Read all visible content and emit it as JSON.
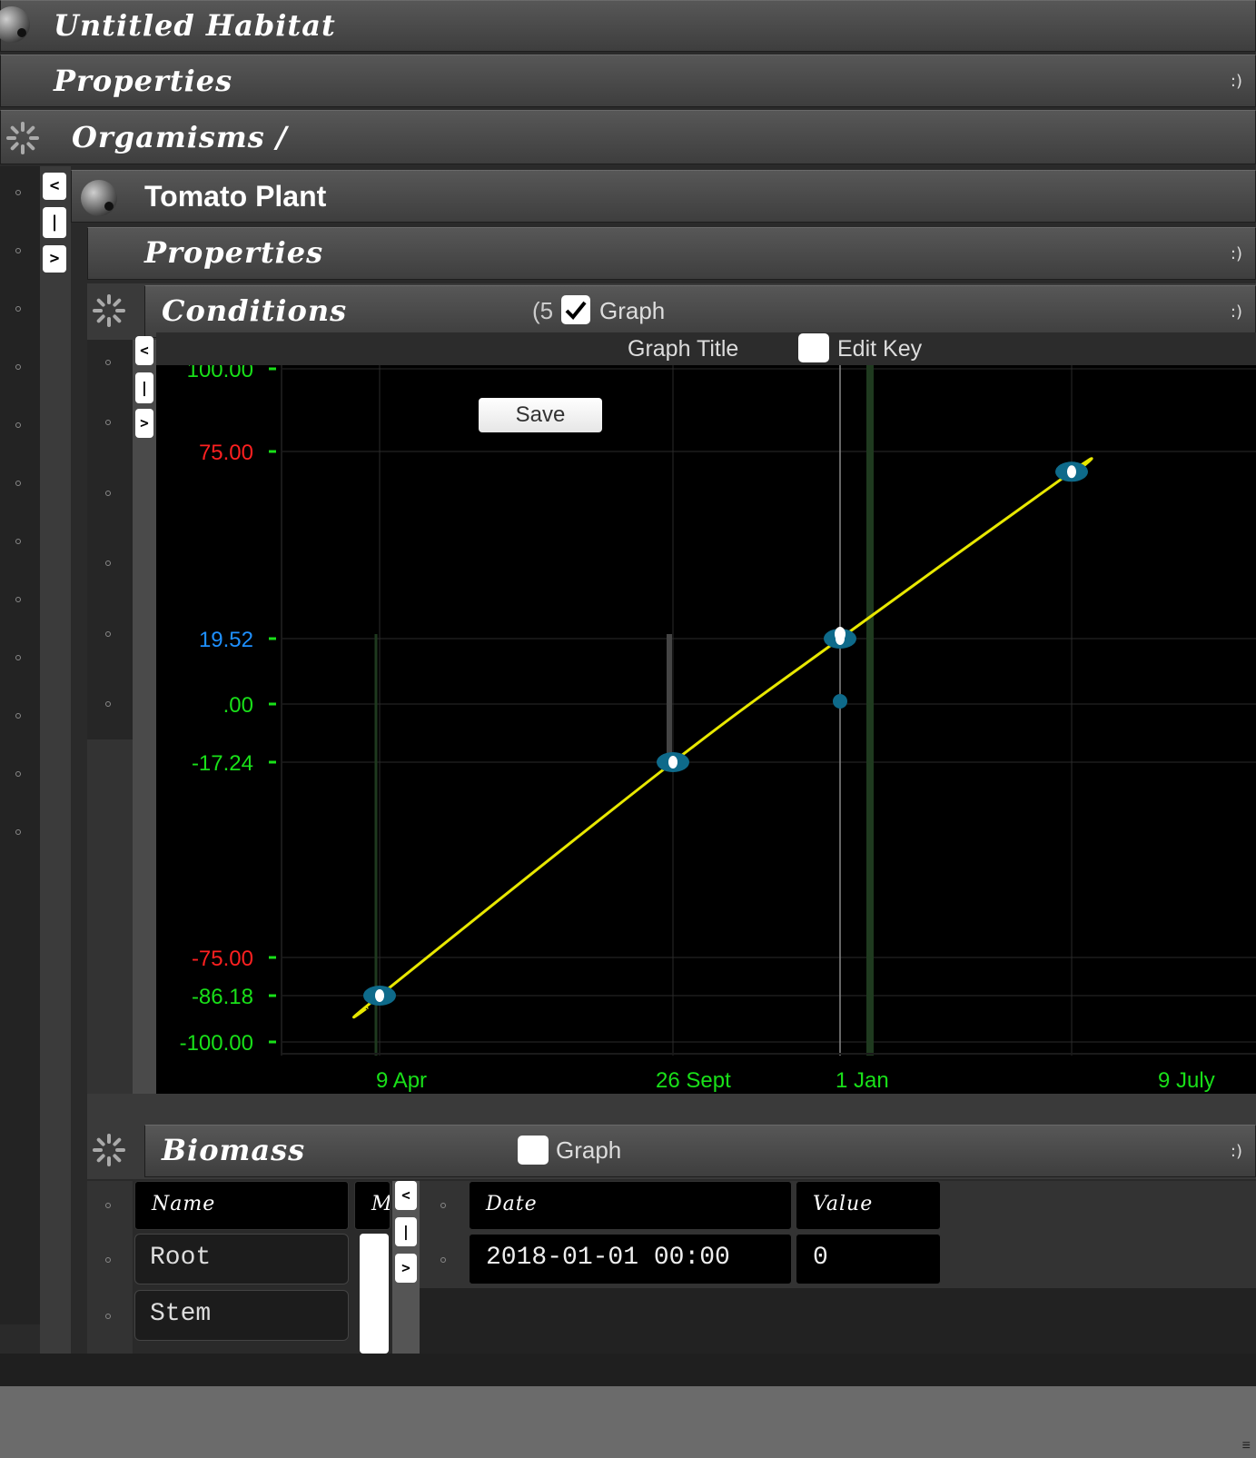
{
  "window": {
    "title": "Untitled Habitat",
    "properties_label": "Properties",
    "smiley": ":)"
  },
  "organisms": {
    "label": "Orgamisms /"
  },
  "organism": {
    "name": "Tomato Plant",
    "properties_label": "Properties"
  },
  "conditions": {
    "label": "Conditions",
    "count": "(5",
    "graph_label": "Graph",
    "graph_checked": true
  },
  "graph": {
    "title": "Graph Title",
    "edit_key_label": "Edit Key",
    "save_label": "Save",
    "y_ticks": [
      {
        "label": "100.00",
        "value": 100,
        "color": "#19e019"
      },
      {
        "label": "75.00",
        "value": 75,
        "color": "#ff2020"
      },
      {
        "label": "19.52",
        "value": 19.52,
        "color": "#1e90ff"
      },
      {
        "label": ".00",
        "value": 0,
        "color": "#19e019"
      },
      {
        "label": "-17.24",
        "value": -17.24,
        "color": "#19e019"
      },
      {
        "label": "-75.00",
        "value": -75,
        "color": "#ff2020"
      },
      {
        "label": "-86.18",
        "value": -86.18,
        "color": "#19e019"
      },
      {
        "label": "-100.00",
        "value": -100,
        "color": "#19e019"
      }
    ],
    "x_ticks": [
      "9 Apr",
      "26 Sept",
      "1 Jan",
      "9 July"
    ]
  },
  "chart_data": {
    "type": "line",
    "x": [
      "9 Apr",
      "26 Sept",
      "1 Jan",
      "9 July"
    ],
    "series": [
      {
        "values": [
          -86.18,
          -17.24,
          19.52,
          69
        ]
      }
    ],
    "ylim": [
      -100,
      100
    ],
    "grid": true,
    "colors": {
      "line": "#e8e800",
      "marker": "#ffffff",
      "marker_halo": "#0e6a8a"
    }
  },
  "biomass": {
    "label": "Biomass",
    "graph_label": "Graph",
    "graph_checked": false,
    "name_header": "Name",
    "m_header": "M",
    "rows": [
      "Root",
      "Stem"
    ],
    "date_header": "Date",
    "value_header": "Value",
    "records": [
      {
        "date": "2018-01-01 00:00",
        "value": "0"
      }
    ]
  },
  "nav": {
    "prev": "<",
    "bar": "|",
    "next": ">"
  }
}
